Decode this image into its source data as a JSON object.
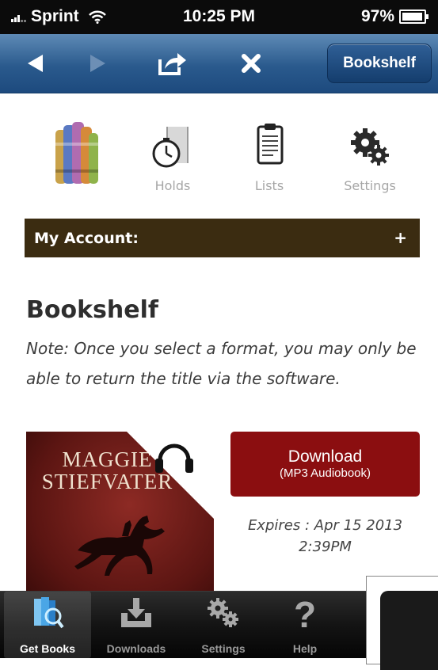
{
  "status_bar": {
    "carrier": "Sprint",
    "time": "10:25 PM",
    "battery": "97%",
    "battery_level": 0.97
  },
  "nav_bar": {
    "bookshelf_label": "Bookshelf"
  },
  "account_icons": [
    {
      "icon": "books-icon",
      "label": ""
    },
    {
      "icon": "holds-icon",
      "label": "Holds"
    },
    {
      "icon": "lists-icon",
      "label": "Lists"
    },
    {
      "icon": "settings-gears-icon",
      "label": "Settings"
    }
  ],
  "account_bar": {
    "title": "My Account:",
    "toggle": "+"
  },
  "content": {
    "heading": "Bookshelf",
    "note": "Note: Once you select a format, you may only be able to return the title via the software."
  },
  "book": {
    "cover_author_line1": "MAGGIE",
    "cover_author_line2": "STIEFVATER",
    "download_label": "Download",
    "format_label": "(MP3 Audiobook)",
    "expires_line1": "Expires : Apr 15 2013",
    "expires_line2": "2:39PM"
  },
  "tab_bar": {
    "tabs": [
      {
        "label": "Get Books",
        "icon": "get-books-icon",
        "active": true
      },
      {
        "label": "Downloads",
        "icon": "downloads-icon",
        "active": false
      },
      {
        "label": "Settings",
        "icon": "settings-icon",
        "active": false
      },
      {
        "label": "Help",
        "icon": "help-icon",
        "active": false
      }
    ]
  },
  "colors": {
    "nav_blue": "#2a5a8d",
    "account_bar": "#3b2c11",
    "download_red": "#8b0e10"
  }
}
